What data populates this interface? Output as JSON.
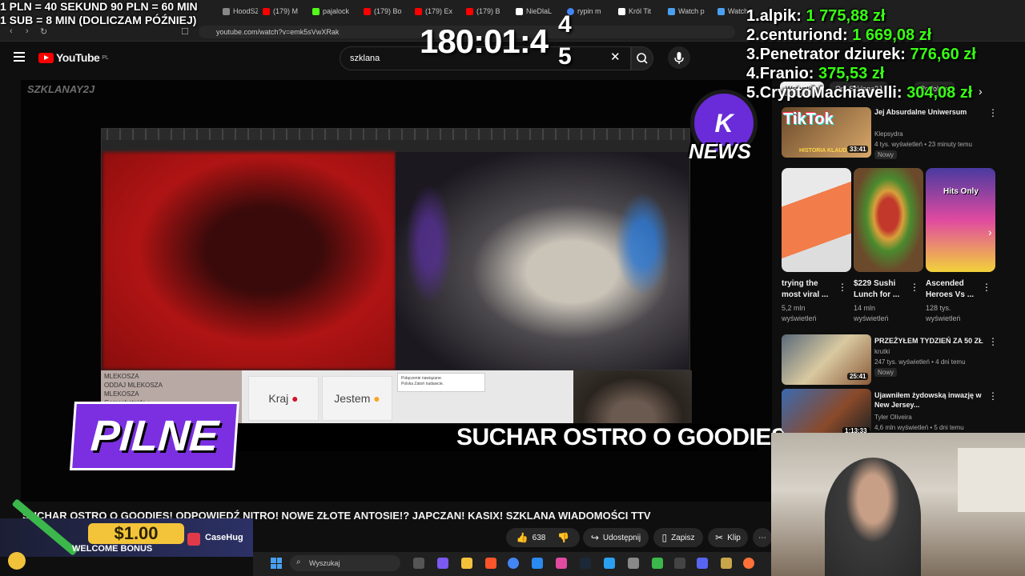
{
  "overlay": {
    "info_line1": "1 PLN =  40 SEKUND 90 PLN = 60 MIN",
    "info_line2": "1 SUB = 8 MIN (DOLICZAM PÓŹNIEJ)",
    "timer_main": "180:01:4",
    "timer_sup": "4",
    "timer_sub": "5",
    "ranking": [
      {
        "pos": "1.",
        "name": "alpik:",
        "amount": "1 775,88 zł"
      },
      {
        "pos": "2.",
        "name": "centuriond:",
        "amount": "1 669,08 zł"
      },
      {
        "pos": "3.",
        "name": "Penetrator dziurek:",
        "amount": "776,60 zł"
      },
      {
        "pos": "4.",
        "name": "Franio:",
        "amount": "375,53 zł"
      },
      {
        "pos": "5.",
        "name": "CryptoMachiavelli:",
        "amount": "304,08 zł"
      }
    ],
    "colors": {
      "ranking_amount": "#39ff14",
      "pilne_bg": "#7b2fe0"
    }
  },
  "browser": {
    "tabs": [
      {
        "label": "HoodSZ",
        "icon": "site-icon"
      },
      {
        "label": "(179) M",
        "icon": "youtube-icon"
      },
      {
        "label": "pajalock",
        "icon": "kick-icon"
      },
      {
        "label": "(179) Bo",
        "icon": "youtube-icon"
      },
      {
        "label": "(179) Ex",
        "icon": "youtube-icon"
      },
      {
        "label": "(179) B",
        "icon": "youtube-icon"
      },
      {
        "label": "NieDlaL",
        "icon": "x-icon"
      },
      {
        "label": "rypin m",
        "icon": "google-icon"
      },
      {
        "label": "Król Tit",
        "icon": "x-icon"
      },
      {
        "label": "Watch p",
        "icon": "site-icon"
      },
      {
        "label": "Watch",
        "icon": "site-icon"
      }
    ],
    "url": "youtube.com/watch?v=emk5sVwXRak"
  },
  "youtube": {
    "logo": "YouTube",
    "logo_region": "PL",
    "search_value": "szklana",
    "video": {
      "channel_watermark": "SZKLANAY2J",
      "badge_pilne": "PILNE",
      "headline": "SUCHAR OSTRO O GOODIES!",
      "knews": "NEWS",
      "strip_buttons": [
        "Kraj",
        "Jestem"
      ],
      "notif_line1": "Połączenie nawiązane.",
      "notif_line2": "Polska Zatoń nadawcie.",
      "chat_lines": [
        "MLEKOSZA",
        "ODDAJ MLEKOSZA",
        "MLEKOSZA",
        "Gamsahatnida :"
      ]
    },
    "title": "SUCHAR OSTRO O GOODIES! ODPOWIEDŹ NITRO! NOWE ZŁOTE ANTOSIE!? JAPCZAN! KASIX! SZKLANA WIADOMOŚCI TTV",
    "actions": {
      "likes": "638",
      "share": "Udostępnij",
      "save": "Zapisz",
      "clip": "Klip"
    },
    "sidebar": {
      "chips": [
        "Wszystkie",
        "Od: Szklana2J",
        "Podobne"
      ],
      "videos": [
        {
          "title": "Jej Absurdalne Uniwersum",
          "channel": "Klepsydra",
          "meta": "4 tys. wyświetleń • 23 minuty temu",
          "badge": "Nowy",
          "duration": "33:41",
          "thumb_label": "HISTORIA KLAUDELL"
        },
        {
          "title": "PRZEŻYŁEM TYDZIEŃ ZA 50 ZŁ",
          "channel": "krutki",
          "meta": "247 tys. wyświetleń • 4 dni temu",
          "badge": "Nowy",
          "duration": "25:41",
          "thumb_label": ""
        },
        {
          "title": "Ujawniłem żydowską inwazję w New Jersey...",
          "channel": "Tyler Oliveira",
          "meta": "4,6 mln wyświetleń • 5 dni temu",
          "badge": "",
          "duration": "1:13:33",
          "thumb_label": ""
        }
      ],
      "shorts": [
        {
          "title": "trying the most viral ...",
          "views": "5,2 mln wyświetleń"
        },
        {
          "title": "$229 Sushi Lunch for ...",
          "views": "14 mln wyświetleń"
        },
        {
          "title": "Ascended Heroes Vs ...",
          "views": "128 tys. wyświetleń",
          "thumb_label": "Hits Only"
        }
      ],
      "tiktok_label": "TikTok"
    }
  },
  "ad": {
    "amount": "$1.00",
    "bonus": "WELCOME BONUS",
    "brand": "CaseHug"
  },
  "taskbar": {
    "search_placeholder": "Wyszukaj"
  }
}
